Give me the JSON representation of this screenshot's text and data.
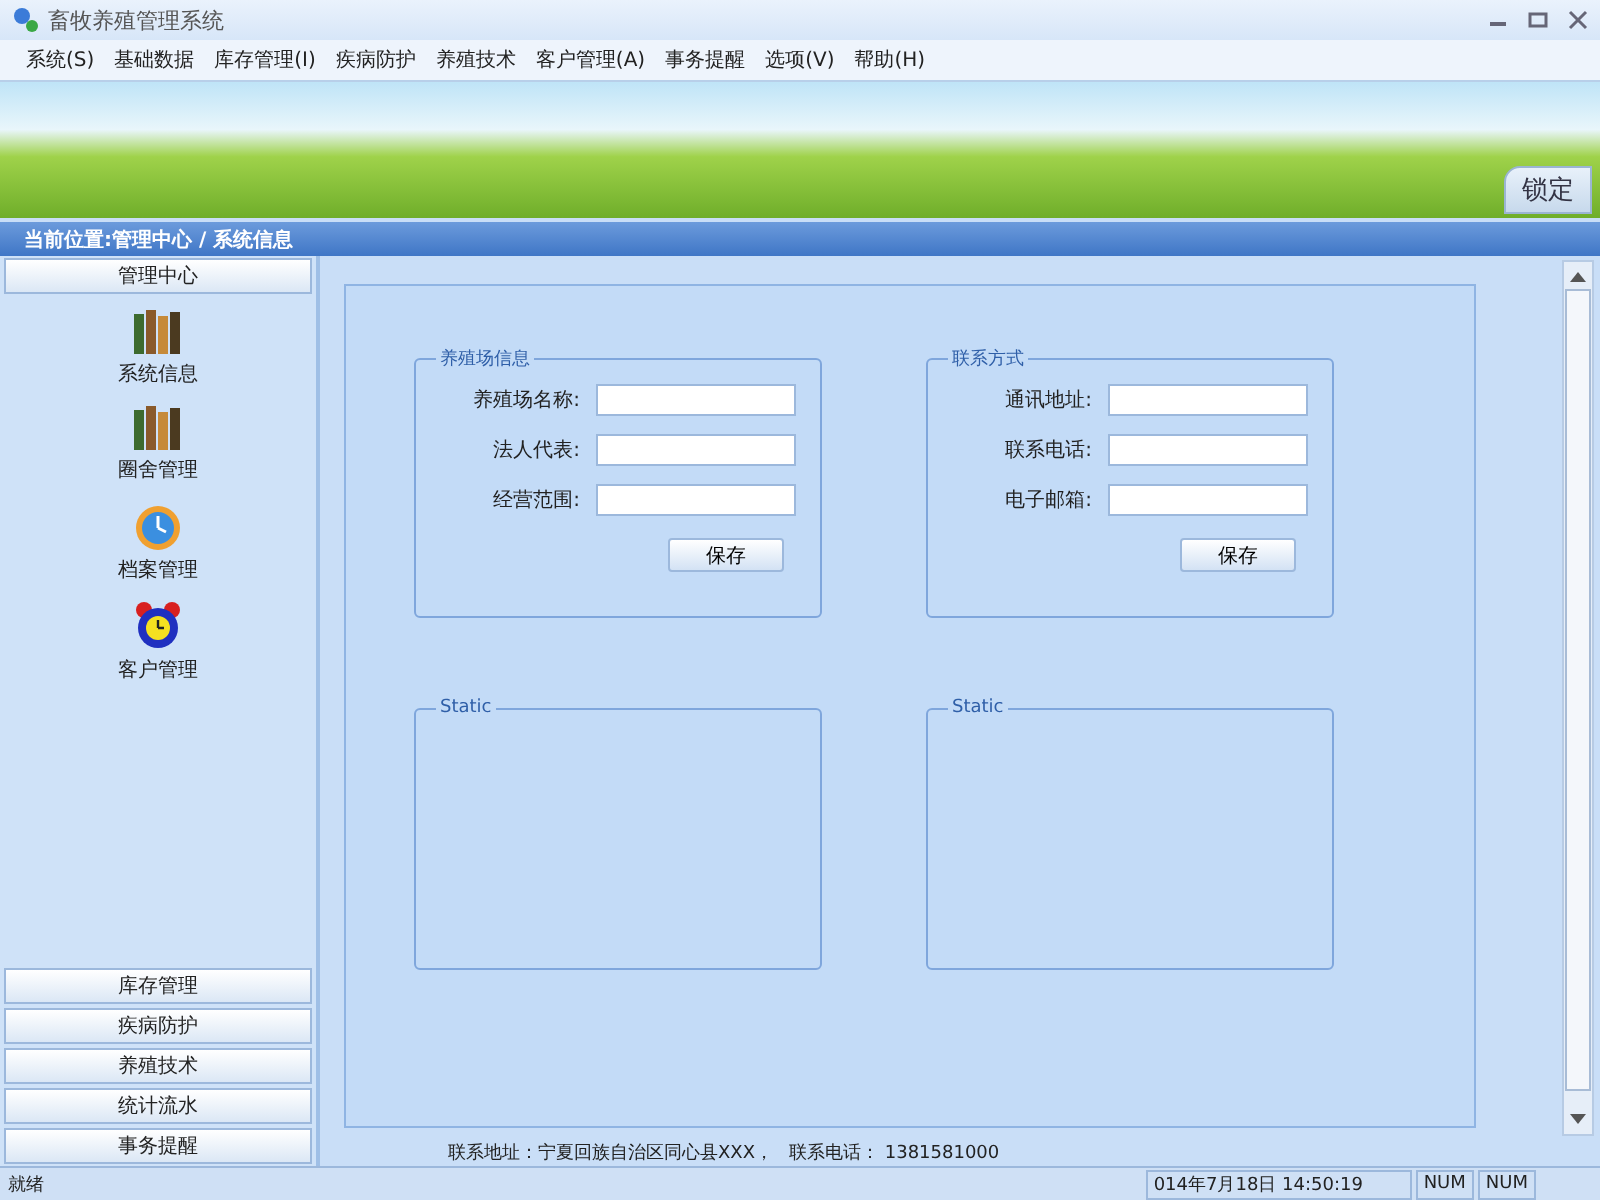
{
  "window": {
    "title": "畜牧养殖管理系统"
  },
  "menu": [
    "系统(S)",
    "基础数据",
    "库存管理(I)",
    "疾病防护",
    "养殖技术",
    "客户管理(A)",
    "事务提醒",
    "选项(V)",
    "帮助(H)"
  ],
  "banner": {
    "lock_button": "锁定"
  },
  "breadcrumb": "当前位置:管理中心 / 系统信息",
  "sidebar": {
    "header": "管理中心",
    "items": [
      {
        "label": "系统信息",
        "kind": "books"
      },
      {
        "label": "圈舍管理",
        "kind": "books"
      },
      {
        "label": "档案管理",
        "kind": "clock"
      },
      {
        "label": "客户管理",
        "kind": "alarm"
      }
    ],
    "sections": [
      "库存管理",
      "疾病防护",
      "养殖技术",
      "统计流水",
      "事务提醒"
    ]
  },
  "groups": [
    {
      "title": "养殖场信息",
      "fields": [
        "养殖场名称:",
        "法人代表:",
        "经营范围:"
      ],
      "button": "保存"
    },
    {
      "title": "联系方式",
      "fields": [
        "通讯地址:",
        "联系电话:",
        "电子邮箱:"
      ],
      "button": "保存"
    },
    {
      "title": "Static"
    },
    {
      "title": "Static"
    }
  ],
  "footer": {
    "address": "联系地址：宁夏回族自治区同心县XXX，",
    "phone": "联系电话： 1381581000"
  },
  "status_bar": {
    "message": "就绪",
    "datetime": "014年7月18日 14:50:19",
    "indicators": [
      "NUM",
      "NUM"
    ]
  }
}
